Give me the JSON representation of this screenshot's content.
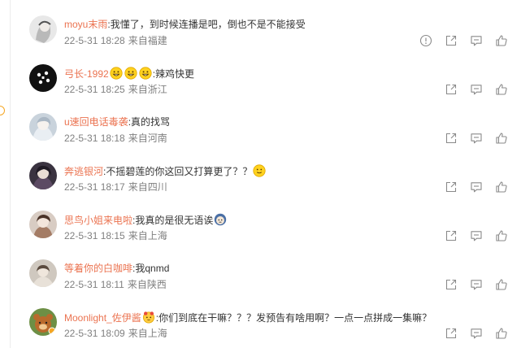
{
  "comments": [
    {
      "user": "moyu末雨",
      "text": "我懂了，到时候连播是吧，倒也不是不能接受",
      "time": "22-5-31 18:28",
      "location": "来自福建",
      "emoji_before": [],
      "emoji_after": [],
      "has_report": true,
      "avatar_bg": "#d9d9d9"
    },
    {
      "user": "弓长-1992",
      "text": "辣鸡快更",
      "time": "22-5-31 18:25",
      "location": "来自浙江",
      "emoji_before": [
        "grin-face-icon",
        "grin-face-icon",
        "grin-face-icon"
      ],
      "emoji_after": [],
      "has_report": false,
      "avatar_bg": "#111111"
    },
    {
      "user": "u速回电话毒袭",
      "text": "真的找骂",
      "time": "22-5-31 18:18",
      "location": "来自河南",
      "emoji_before": [],
      "emoji_after": [],
      "has_report": false,
      "avatar_bg": "#c9d3dc"
    },
    {
      "user": "奔逃银河",
      "text": "不摇碧莲的你这回又打算更了？？",
      "time": "22-5-31 18:17",
      "location": "来自四川",
      "emoji_before": [],
      "emoji_after": [
        "smile-face-icon"
      ],
      "has_report": false,
      "avatar_bg": "#3a3340"
    },
    {
      "user": "思鸟小姐来电啦",
      "text": "我真的是很无语诶",
      "time": "22-5-31 18:15",
      "location": "来自上海",
      "emoji_before": [],
      "emoji_after": [
        "speechless-face-icon"
      ],
      "has_report": false,
      "avatar_bg": "#d8ccc3"
    },
    {
      "user": "等着你的白咖啡",
      "text": "我qnmd",
      "time": "22-5-31 18:11",
      "location": "来自陕西",
      "emoji_before": [],
      "emoji_after": [],
      "has_report": false,
      "avatar_bg": "#cfc8bf"
    },
    {
      "user": "Moonlight_佐伊酱",
      "text": "你们到底在干嘛？？？发预告有啥用啊？一点一点拼成一集嘛？",
      "time": "22-5-31 18:09",
      "location": "来自上海",
      "emoji_before": [
        "cute-face-icon"
      ],
      "emoji_after": [],
      "has_report": false,
      "avatar_bg": "#6d8f45"
    }
  ],
  "colors": {
    "username": "#eb7350",
    "meta": "#808080",
    "text": "#333333",
    "icon": "#8a8a8a"
  }
}
